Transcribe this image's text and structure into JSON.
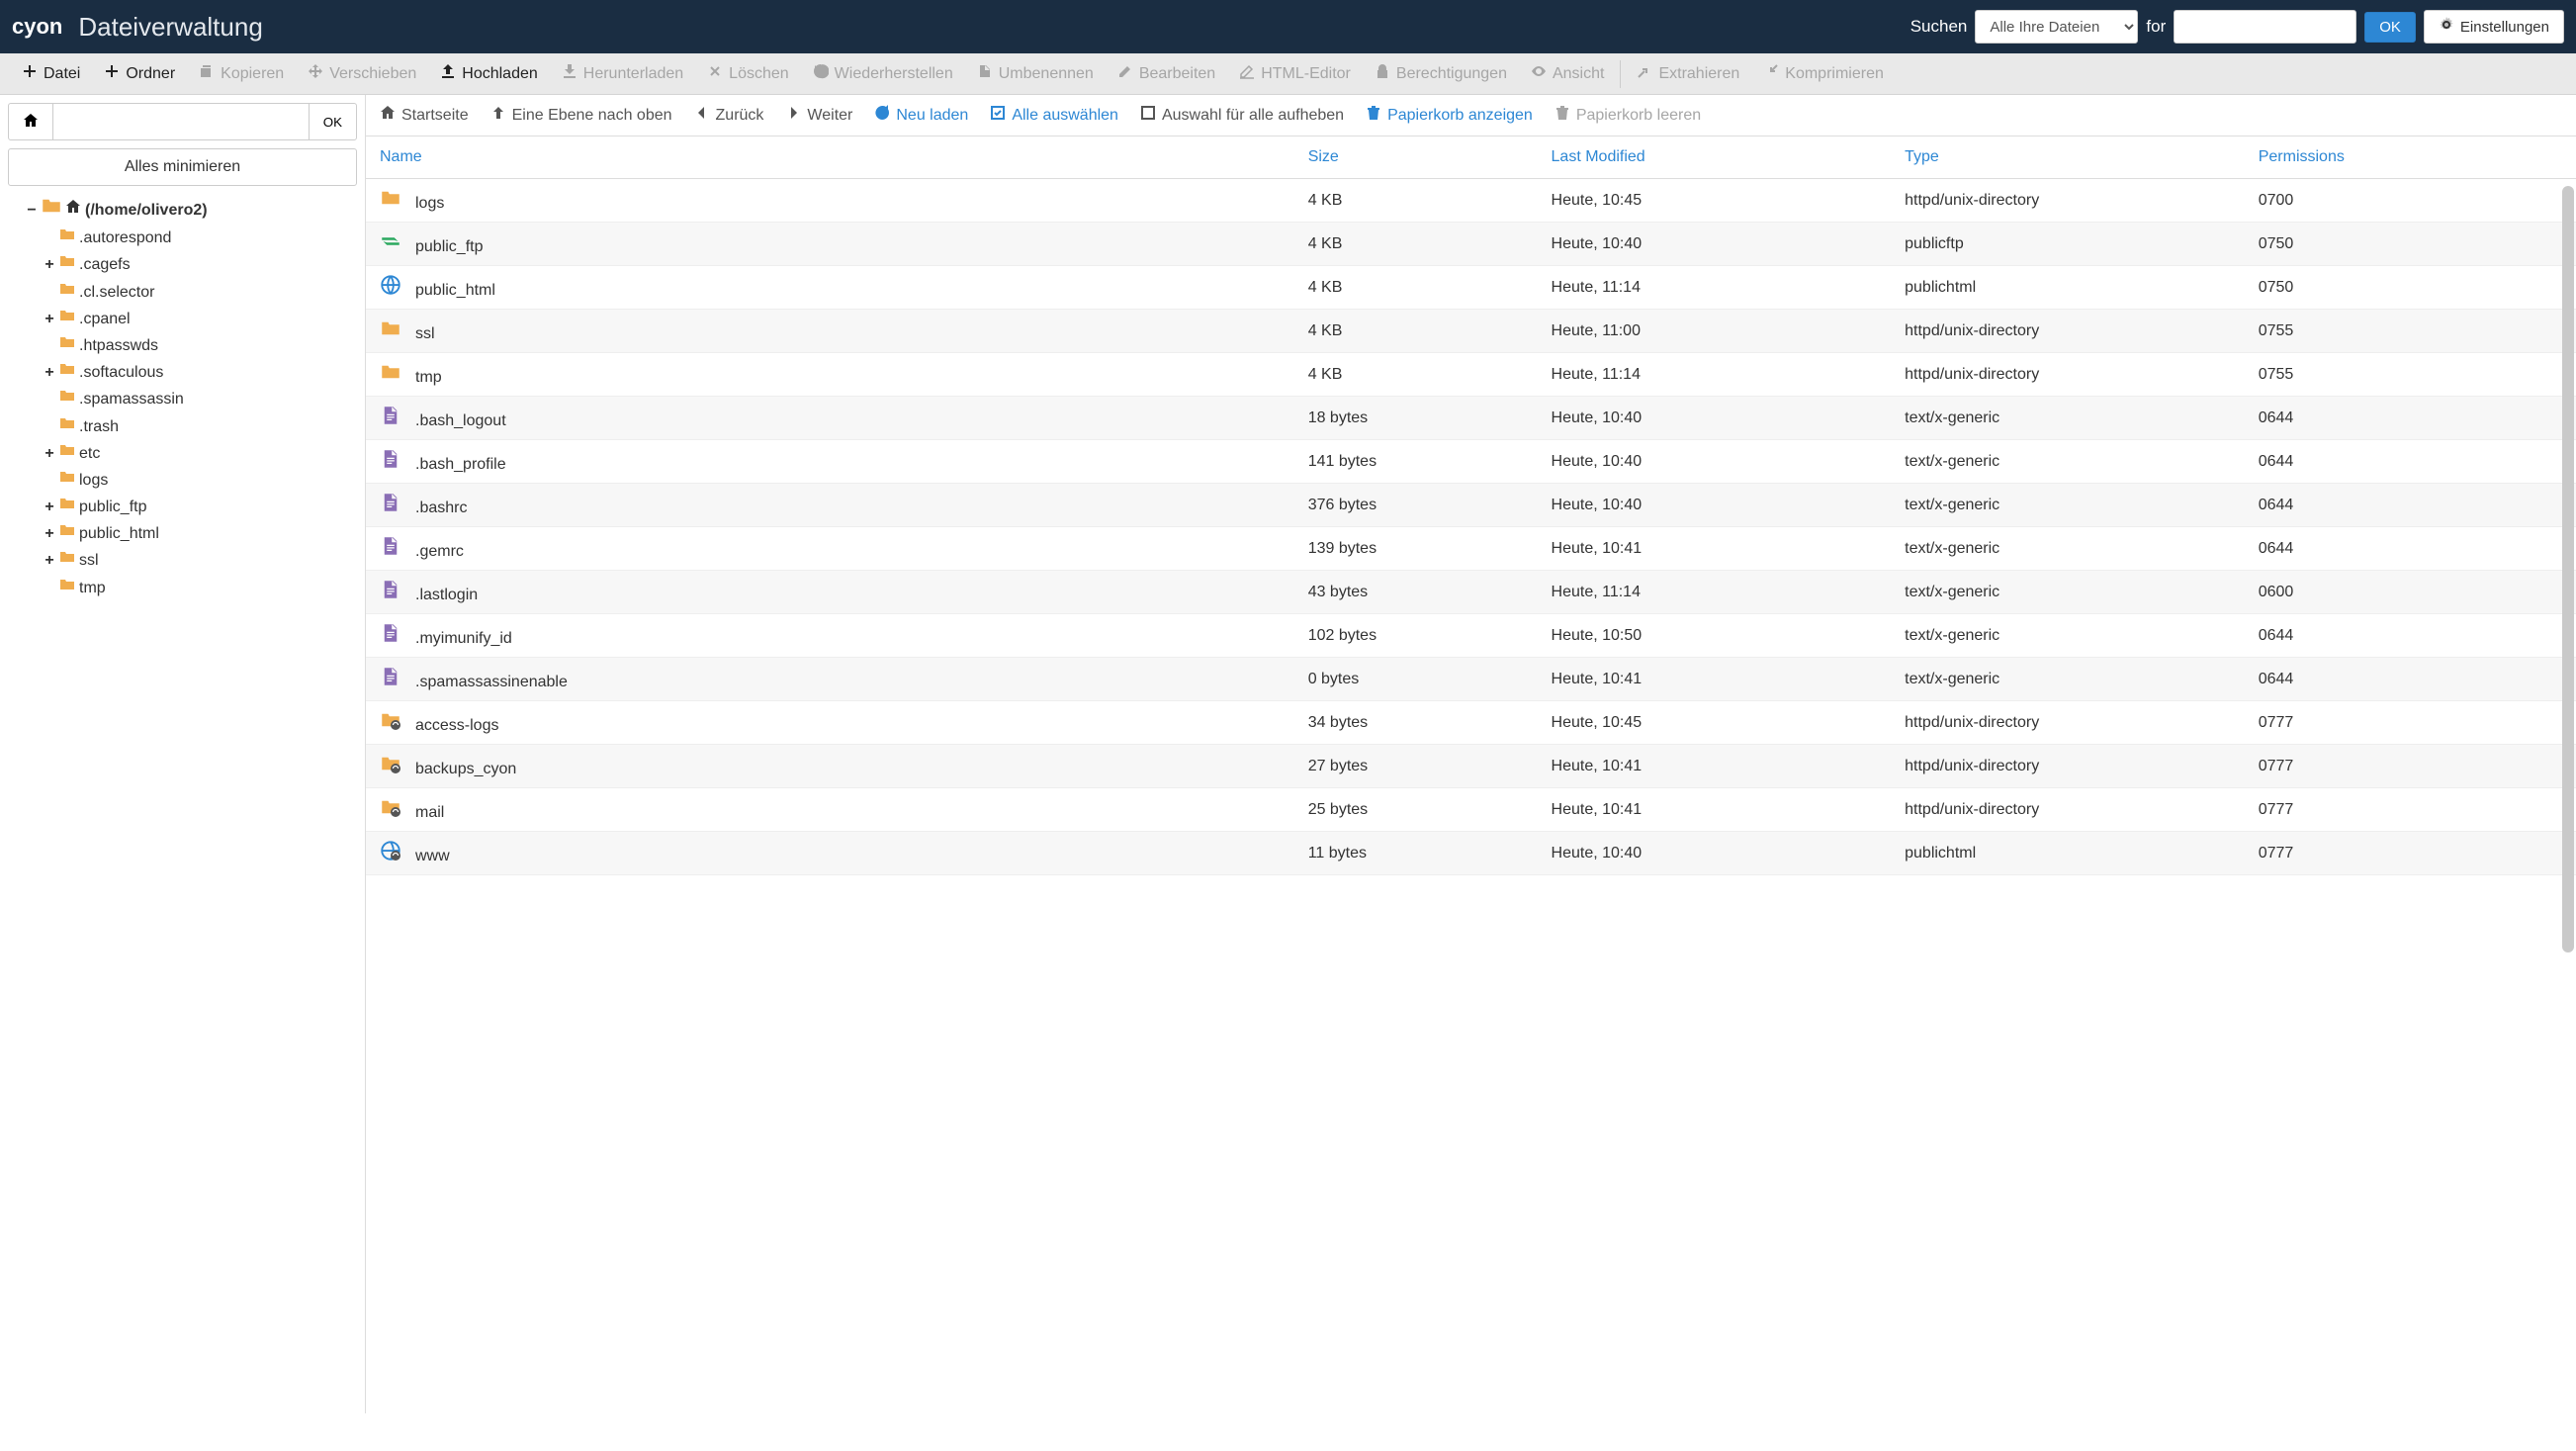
{
  "header": {
    "logo": "cyon",
    "title": "Dateiverwaltung",
    "search_label": "Suchen",
    "search_scope": "Alle Ihre Dateien",
    "for_label": "for",
    "ok": "OK",
    "settings": "Einstellungen"
  },
  "toolbar": [
    {
      "icon": "plus",
      "label": "Datei",
      "enabled": true
    },
    {
      "icon": "plus",
      "label": "Ordner",
      "enabled": true
    },
    {
      "icon": "copy",
      "label": "Kopieren",
      "enabled": false
    },
    {
      "icon": "move",
      "label": "Verschieben",
      "enabled": false
    },
    {
      "icon": "upload",
      "label": "Hochladen",
      "enabled": true
    },
    {
      "icon": "download",
      "label": "Herunterladen",
      "enabled": false
    },
    {
      "icon": "delete",
      "label": "Löschen",
      "enabled": false
    },
    {
      "icon": "restore",
      "label": "Wiederherstellen",
      "enabled": false
    },
    {
      "icon": "rename",
      "label": "Umbenennen",
      "enabled": false
    },
    {
      "icon": "edit",
      "label": "Bearbeiten",
      "enabled": false
    },
    {
      "icon": "html",
      "label": "HTML-Editor",
      "enabled": false
    },
    {
      "icon": "perm",
      "label": "Berechtigungen",
      "enabled": false
    },
    {
      "icon": "view",
      "label": "Ansicht",
      "enabled": false
    },
    {
      "sep": true
    },
    {
      "icon": "extract",
      "label": "Extrahieren",
      "enabled": false
    },
    {
      "icon": "compress",
      "label": "Komprimieren",
      "enabled": false
    }
  ],
  "sidebar": {
    "ok": "OK",
    "path_value": "",
    "collapse_all": "Alles minimieren",
    "root_label": "(/home/olivero2)",
    "tree": [
      {
        "name": ".autorespond",
        "expandable": false
      },
      {
        "name": ".cagefs",
        "expandable": true
      },
      {
        "name": ".cl.selector",
        "expandable": false
      },
      {
        "name": ".cpanel",
        "expandable": true
      },
      {
        "name": ".htpasswds",
        "expandable": false
      },
      {
        "name": ".softaculous",
        "expandable": true
      },
      {
        "name": ".spamassassin",
        "expandable": false
      },
      {
        "name": ".trash",
        "expandable": false
      },
      {
        "name": "etc",
        "expandable": true
      },
      {
        "name": "logs",
        "expandable": false
      },
      {
        "name": "public_ftp",
        "expandable": true
      },
      {
        "name": "public_html",
        "expandable": true
      },
      {
        "name": "ssl",
        "expandable": true
      },
      {
        "name": "tmp",
        "expandable": false
      }
    ]
  },
  "actions": {
    "home": "Startseite",
    "up": "Eine Ebene nach oben",
    "back": "Zurück",
    "forward": "Weiter",
    "reload": "Neu laden",
    "select_all": "Alle auswählen",
    "unselect_all": "Auswahl für alle aufheben",
    "show_trash": "Papierkorb anzeigen",
    "empty_trash": "Papierkorb leeren"
  },
  "columns": {
    "name": "Name",
    "size": "Size",
    "modified": "Last Modified",
    "type": "Type",
    "perm": "Permissions"
  },
  "rows": [
    {
      "icon": "folder",
      "name": "logs",
      "size": "4 KB",
      "modified": "Heute, 10:45",
      "type": "httpd/unix-directory",
      "perm": "0700"
    },
    {
      "icon": "ftp",
      "name": "public_ftp",
      "size": "4 KB",
      "modified": "Heute, 10:40",
      "type": "publicftp",
      "perm": "0750"
    },
    {
      "icon": "globe",
      "name": "public_html",
      "size": "4 KB",
      "modified": "Heute, 11:14",
      "type": "publichtml",
      "perm": "0750"
    },
    {
      "icon": "folder",
      "name": "ssl",
      "size": "4 KB",
      "modified": "Heute, 11:00",
      "type": "httpd/unix-directory",
      "perm": "0755"
    },
    {
      "icon": "folder",
      "name": "tmp",
      "size": "4 KB",
      "modified": "Heute, 11:14",
      "type": "httpd/unix-directory",
      "perm": "0755"
    },
    {
      "icon": "file",
      "name": ".bash_logout",
      "size": "18 bytes",
      "modified": "Heute, 10:40",
      "type": "text/x-generic",
      "perm": "0644"
    },
    {
      "icon": "file",
      "name": ".bash_profile",
      "size": "141 bytes",
      "modified": "Heute, 10:40",
      "type": "text/x-generic",
      "perm": "0644"
    },
    {
      "icon": "file",
      "name": ".bashrc",
      "size": "376 bytes",
      "modified": "Heute, 10:40",
      "type": "text/x-generic",
      "perm": "0644"
    },
    {
      "icon": "file",
      "name": ".gemrc",
      "size": "139 bytes",
      "modified": "Heute, 10:41",
      "type": "text/x-generic",
      "perm": "0644"
    },
    {
      "icon": "file",
      "name": ".lastlogin",
      "size": "43 bytes",
      "modified": "Heute, 11:14",
      "type": "text/x-generic",
      "perm": "0600"
    },
    {
      "icon": "file",
      "name": ".myimunify_id",
      "size": "102 bytes",
      "modified": "Heute, 10:50",
      "type": "text/x-generic",
      "perm": "0644"
    },
    {
      "icon": "file",
      "name": ".spamassassinenable",
      "size": "0 bytes",
      "modified": "Heute, 10:41",
      "type": "text/x-generic",
      "perm": "0644"
    },
    {
      "icon": "folderlink",
      "name": "access-logs",
      "size": "34 bytes",
      "modified": "Heute, 10:45",
      "type": "httpd/unix-directory",
      "perm": "0777"
    },
    {
      "icon": "folderlink",
      "name": "backups_cyon",
      "size": "27 bytes",
      "modified": "Heute, 10:41",
      "type": "httpd/unix-directory",
      "perm": "0777"
    },
    {
      "icon": "folderlink",
      "name": "mail",
      "size": "25 bytes",
      "modified": "Heute, 10:41",
      "type": "httpd/unix-directory",
      "perm": "0777"
    },
    {
      "icon": "globelink",
      "name": "www",
      "size": "11 bytes",
      "modified": "Heute, 10:40",
      "type": "publichtml",
      "perm": "0777"
    }
  ]
}
